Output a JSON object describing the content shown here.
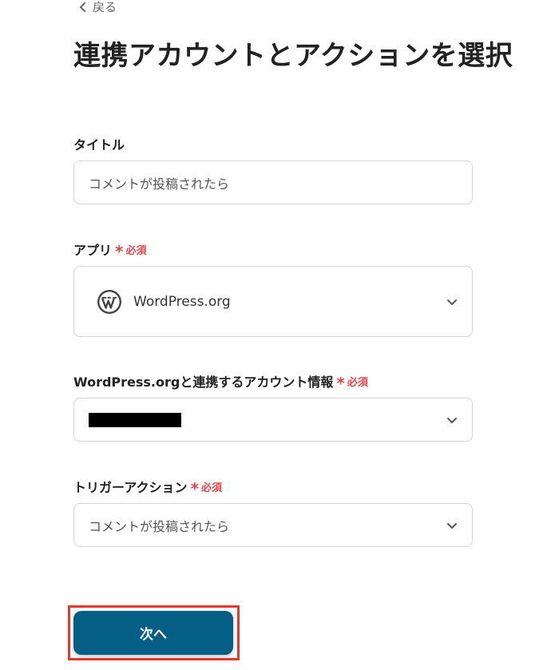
{
  "nav": {
    "back_label": "戻る"
  },
  "page": {
    "title": "連携アカウントとアクションを選択"
  },
  "fields": {
    "title": {
      "label": "タイトル",
      "value": "コメントが投稿されたら"
    },
    "app": {
      "label": "アプリ",
      "required_label": "必須",
      "value": "WordPress.org",
      "icon": "wordpress-logo-icon"
    },
    "account": {
      "label": "WordPress.orgと連携するアカウント情報",
      "required_label": "必須",
      "value_redacted": true
    },
    "trigger": {
      "label": "トリガーアクション",
      "required_label": "必須",
      "value": "コメントが投稿されたら"
    }
  },
  "actions": {
    "next_label": "次へ"
  },
  "colors": {
    "primary_button": "#055e86",
    "required": "#e0474c",
    "highlight_border": "#e43a2b"
  }
}
